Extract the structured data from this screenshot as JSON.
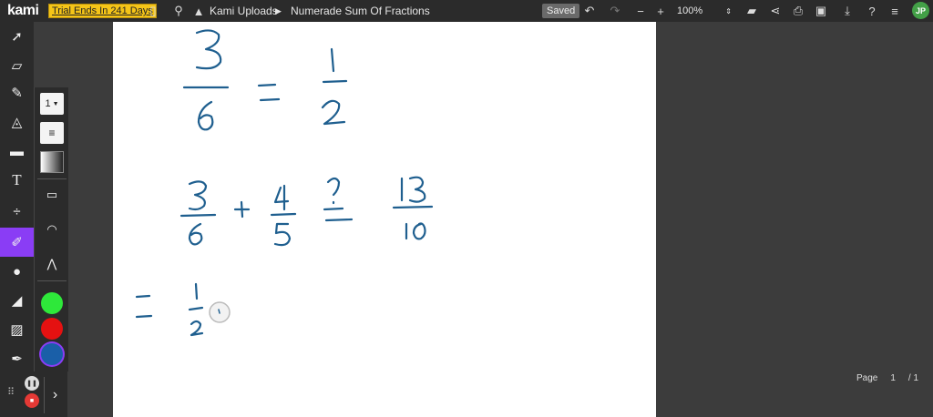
{
  "app": {
    "logo": "kami",
    "trial_label": "Trial Ends In 241 Days",
    "breadcrumb_root": "Kami Uploads",
    "document_title": "Numerade Sum Of Fractions",
    "save_status": "Saved",
    "zoom_level": "100%",
    "user_initials": "JP"
  },
  "toolbar_icons": [
    "sidebar-toggle-icon",
    "search-icon",
    "drive-icon",
    "undo-icon",
    "redo-icon",
    "zoom-out-icon",
    "zoom-in-icon",
    "open-folder-icon",
    "share-icon",
    "print-icon",
    "save-icon",
    "download-icon",
    "help-icon",
    "menu-icon"
  ],
  "left_tools": [
    "select-tool",
    "markup-tool",
    "text-box-tool",
    "highlight-tool",
    "comment-tool",
    "text-tool",
    "equation-tool",
    "drawing-tool",
    "shapes-tool",
    "eraser-tool",
    "image-tool",
    "signature-tool"
  ],
  "drawing_panel": {
    "stroke_width": "1",
    "colors": [
      "#2ee83a",
      "#e51111",
      "#1a5fa8"
    ]
  },
  "pager": {
    "label": "Page",
    "current": "1",
    "total": "/ 1"
  },
  "handwriting": {
    "line1": {
      "left": "3/6",
      "op": "=",
      "right": "1/2"
    },
    "line2": {
      "a": "3/6",
      "op1": "+",
      "b": "4/5",
      "op2": "?=",
      "result": "13/10"
    },
    "line3": {
      "op": "=",
      "value": "1/2"
    }
  }
}
